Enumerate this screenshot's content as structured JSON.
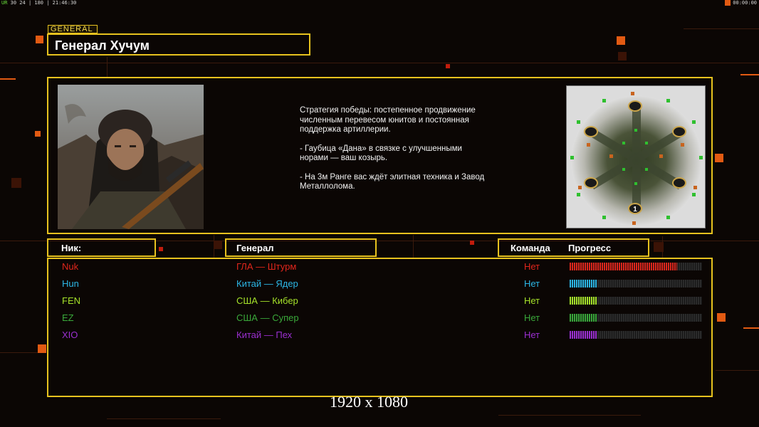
{
  "hud": {
    "left_prefix": "UR",
    "left_stats": "30 24 | 180 | 21:46:30",
    "right_time": "00:00:00"
  },
  "header": {
    "tag": "GENERAL",
    "title": "Генерал Хучум"
  },
  "description": {
    "paragraphs": [
      "Стратегия победы: постепенное продвижение численным перевесом юнитов и постоянная поддержка артиллерии.",
      "- Гаубица «Дана» в связке с улучшенными норами — ваш козырь.",
      "- На 3м Ранге вас ждёт элитная техника и Завод Металлолома."
    ]
  },
  "minimap": {
    "marker_label": "1"
  },
  "columns": {
    "nick": "Ник:",
    "general": "Генерал",
    "team": "Команда",
    "progress": "Прогресс"
  },
  "players": [
    {
      "nick": "Nuk",
      "general": "ГЛА — Штурм",
      "team": "Нет",
      "color": "#e0261c",
      "progress": 0.81
    },
    {
      "nick": "Hun",
      "general": "Китай — Ядер",
      "team": "Нет",
      "color": "#2cb6e6",
      "progress": 0.21
    },
    {
      "nick": "FEN",
      "general": "США — Кибер",
      "team": "Нет",
      "color": "#a6e22a",
      "progress": 0.21
    },
    {
      "nick": "EZ",
      "general": "США — Супер",
      "team": "Нет",
      "color": "#3aa83a",
      "progress": 0.21
    },
    {
      "nick": "XIO",
      "general": "Китай — Пех",
      "team": "Нет",
      "color": "#9b2fd0",
      "progress": 0.21
    }
  ],
  "resolution_label": "1920 x 1080",
  "accent_color": "#e7c21e"
}
